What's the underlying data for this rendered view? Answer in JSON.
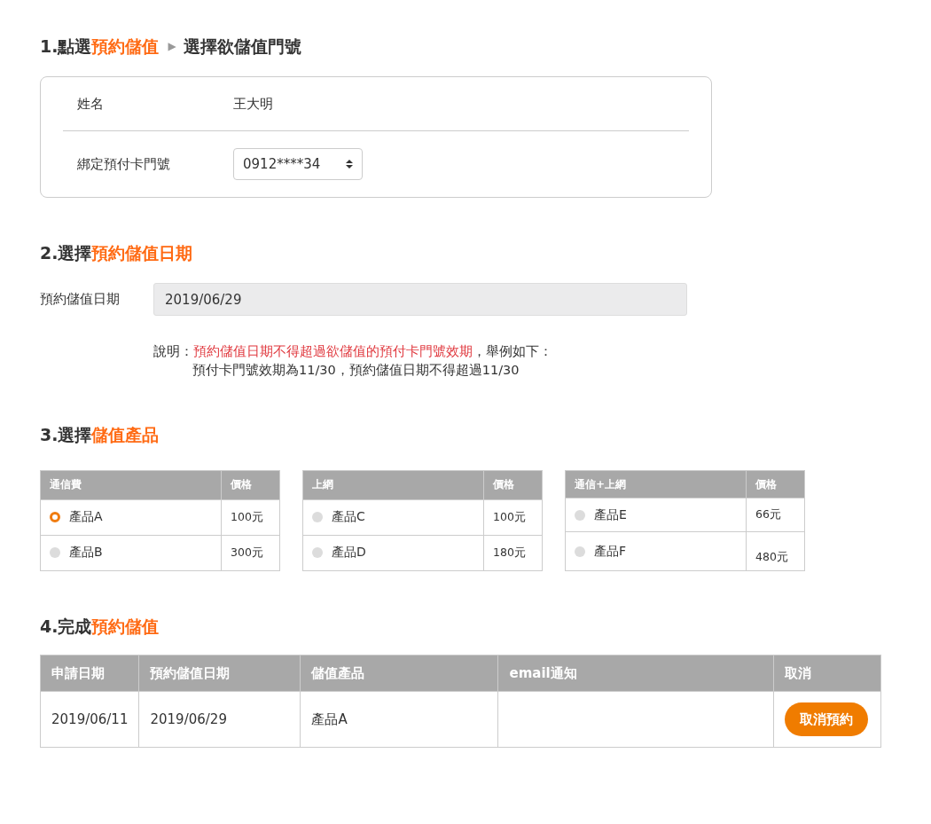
{
  "step1": {
    "heading": [
      {
        "text": "1.點選",
        "kind": "plain"
      },
      {
        "text": "預約儲值",
        "kind": "accent"
      },
      {
        "text": "▶",
        "kind": "arrow"
      },
      {
        "text": "選擇欲儲值門號",
        "kind": "plain"
      }
    ],
    "name_label": "姓名",
    "name_value": "王大明",
    "number_label": "綁定預付卡門號",
    "number_value": "0912****34"
  },
  "step2": {
    "heading": [
      {
        "text": "2.選擇",
        "kind": "plain"
      },
      {
        "text": "預約儲值日期",
        "kind": "accent"
      }
    ],
    "date_label": "預約儲值日期",
    "date_value": "2019/06/29",
    "note": {
      "label": "說明：",
      "highlight": "預約儲值日期不得超過欲儲值的預付卡門號效期",
      "rest": "，舉例如下：",
      "example": "預付卡門號效期為11/30，預約儲值日期不得超過11/30"
    }
  },
  "step3": {
    "heading": [
      {
        "text": "3.選擇",
        "kind": "plain"
      },
      {
        "text": "儲值產品",
        "kind": "accent"
      }
    ],
    "tables": [
      {
        "category": "通信費",
        "price_header": "價格",
        "rows": [
          {
            "name": "產品A",
            "price": "100元",
            "selected": true
          },
          {
            "name": "產品B",
            "price": "300元",
            "selected": false
          }
        ]
      },
      {
        "category": "上網",
        "price_header": "價格",
        "rows": [
          {
            "name": "產品C",
            "price": "100元",
            "selected": false
          },
          {
            "name": "產品D",
            "price": "180元",
            "selected": false
          }
        ]
      },
      {
        "category": "通信+上網",
        "price_header": "價格",
        "rows": [
          {
            "name": "產品E",
            "price": "66元",
            "selected": false
          },
          {
            "name": "產品F",
            "price": "480元",
            "selected": false
          }
        ]
      }
    ]
  },
  "step4": {
    "heading": [
      {
        "text": "4.完成",
        "kind": "plain"
      },
      {
        "text": "預約儲值",
        "kind": "accent"
      }
    ],
    "columns": [
      "申請日期",
      "預約儲值日期",
      "儲值產品",
      "email通知",
      "取消"
    ],
    "rows": [
      {
        "apply_date": "2019/06/11",
        "reserve_date": "2019/06/29",
        "product": "產品A",
        "cancel_button": "取消預約"
      }
    ]
  }
}
